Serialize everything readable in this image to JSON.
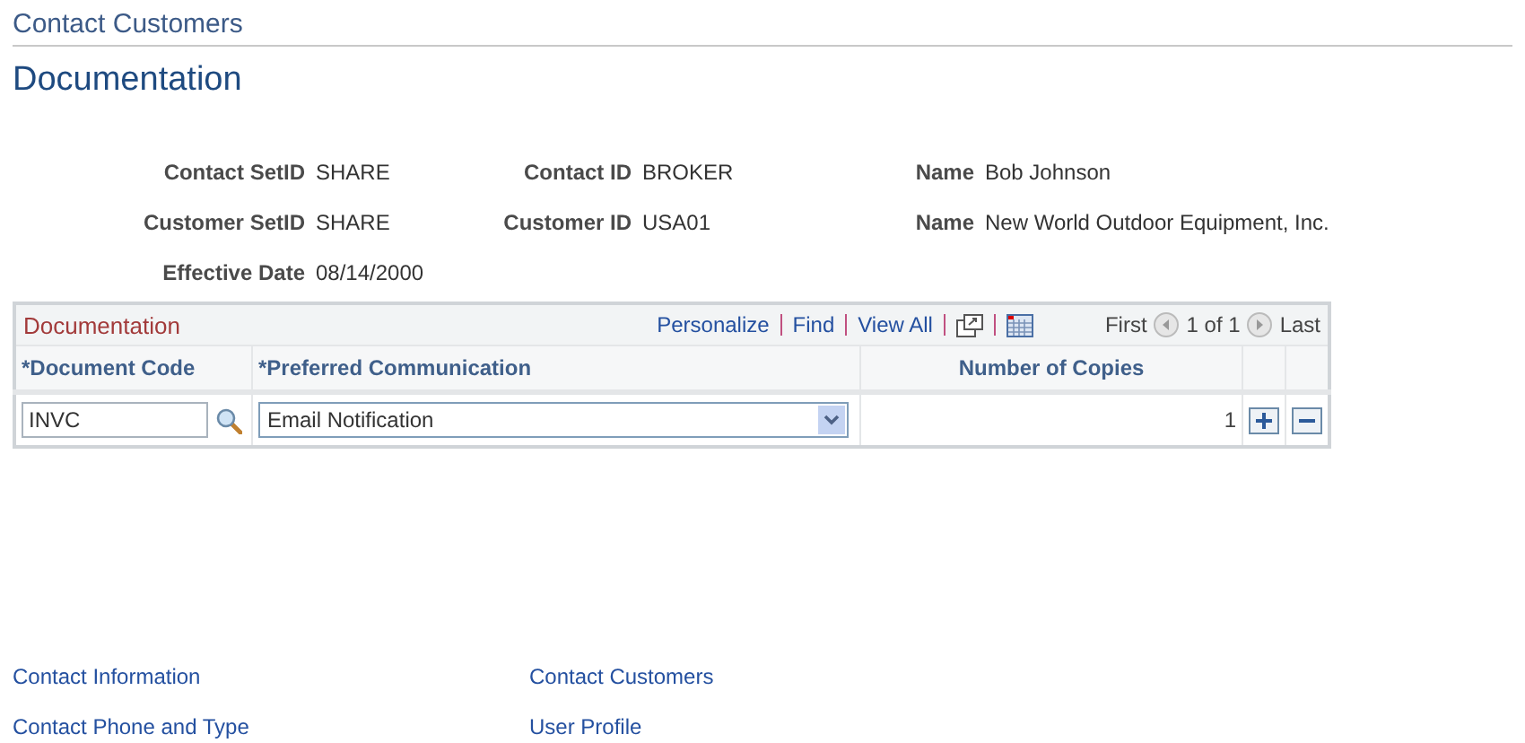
{
  "breadcrumb": "Contact Customers",
  "page_title": "Documentation",
  "fields": [
    {
      "label": "Contact SetID",
      "value": "SHARE"
    },
    {
      "label": "Contact ID",
      "value": "BROKER"
    },
    {
      "label": "Name",
      "value": "Bob Johnson"
    },
    {
      "label": "Customer SetID",
      "value": "SHARE"
    },
    {
      "label": "Customer ID",
      "value": "USA01"
    },
    {
      "label": "Name",
      "value": "New World Outdoor Equipment, Inc."
    },
    {
      "label": "Effective Date",
      "value": "08/14/2000"
    }
  ],
  "grid": {
    "title": "Documentation",
    "toolbar_links": [
      "Personalize",
      "Find",
      "View All"
    ],
    "pager": {
      "first": "First",
      "count": "1 of 1",
      "last": "Last"
    },
    "columns": [
      "*Document Code",
      "*Preferred Communication",
      "Number of Copies"
    ],
    "rows": [
      {
        "document_code": "INVC",
        "preferred_communication": "Email Notification",
        "copies": "1"
      }
    ]
  },
  "footer_links": [
    "Contact Information",
    "Contact Customers",
    "Contact Phone and Type",
    "User Profile"
  ]
}
